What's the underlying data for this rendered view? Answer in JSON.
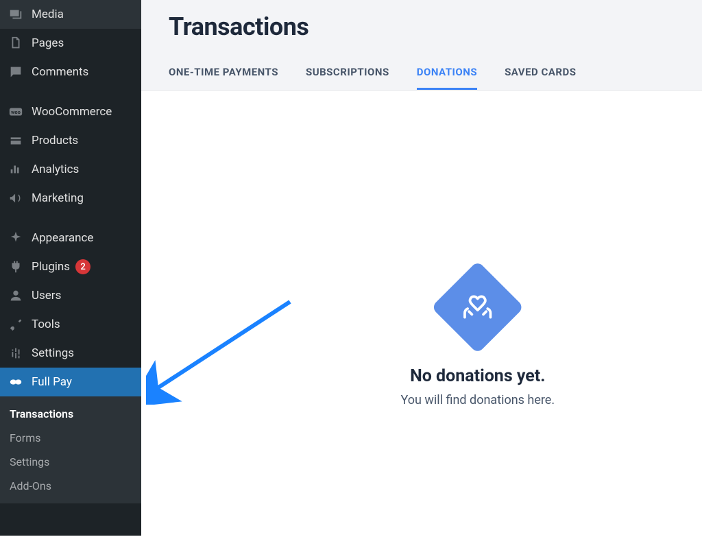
{
  "sidebar": {
    "items": [
      {
        "label": "Media",
        "icon": "media"
      },
      {
        "label": "Pages",
        "icon": "pages"
      },
      {
        "label": "Comments",
        "icon": "comments"
      },
      {
        "spacer": true
      },
      {
        "label": "WooCommerce",
        "icon": "woo"
      },
      {
        "label": "Products",
        "icon": "products"
      },
      {
        "label": "Analytics",
        "icon": "analytics"
      },
      {
        "label": "Marketing",
        "icon": "marketing"
      },
      {
        "spacer": true
      },
      {
        "label": "Appearance",
        "icon": "appearance"
      },
      {
        "label": "Plugins",
        "icon": "plugins",
        "badge": "2"
      },
      {
        "label": "Users",
        "icon": "users"
      },
      {
        "label": "Tools",
        "icon": "tools"
      },
      {
        "label": "Settings",
        "icon": "settings"
      },
      {
        "label": "Full Pay",
        "icon": "fullpay",
        "active": true
      }
    ],
    "submenu": [
      {
        "label": "Transactions",
        "current": true
      },
      {
        "label": "Forms"
      },
      {
        "label": "Settings"
      },
      {
        "label": "Add-Ons"
      }
    ]
  },
  "main": {
    "page_title": "Transactions",
    "tabs": [
      {
        "label": "ONE-TIME PAYMENTS"
      },
      {
        "label": "SUBSCRIPTIONS"
      },
      {
        "label": "DONATIONS",
        "active": true
      },
      {
        "label": "SAVED CARDS"
      }
    ],
    "empty": {
      "title": "No donations yet.",
      "subtitle": "You will find donations here."
    }
  }
}
